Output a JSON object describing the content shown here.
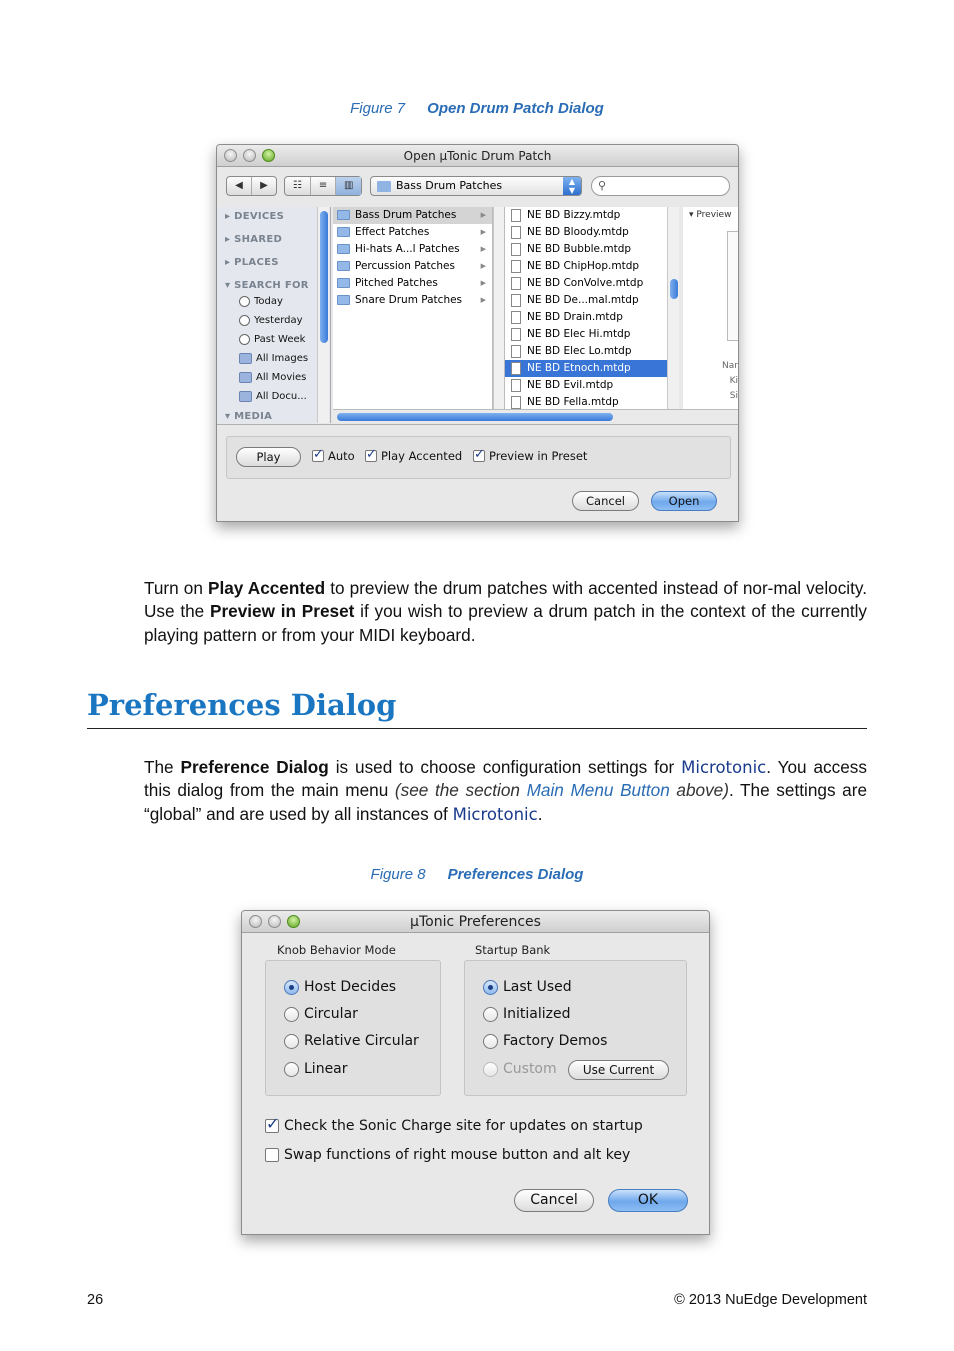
{
  "figure7": {
    "number": "Figure 7",
    "title": "Open Drum Patch Dialog"
  },
  "open_dialog": {
    "title": "Open µTonic Drum Patch",
    "nav_back": "◀",
    "nav_forward": "▶",
    "view_icon": "☷",
    "view_list": "≡",
    "view_columns": "▥",
    "location": "Bass Drum Patches",
    "search_icon": "⚲",
    "sidebar": {
      "devices": "DEVICES",
      "shared": "SHARED",
      "places": "PLACES",
      "search_for": "SEARCH FOR",
      "items": [
        "Today",
        "Yesterday",
        "Past Week",
        "All Images",
        "All Movies",
        "All Docu..."
      ],
      "media": "MEDIA"
    },
    "folders": [
      "Bass Drum Patches",
      "Effect Patches",
      "Hi-hats A...l Patches",
      "Percussion Patches",
      "Pitched Patches",
      "Snare Drum Patches"
    ],
    "files": [
      "NE BD Bizzy.mtdp",
      "NE BD Bloody.mtdp",
      "NE BD Bubble.mtdp",
      "NE BD ChipHop.mtdp",
      "NE BD ConVolve.mtdp",
      "NE BD De...mal.mtdp",
      "NE BD Drain.mtdp",
      "NE BD Elec Hi.mtdp",
      "NE BD Elec Lo.mtdp",
      "NE BD Etnoch.mtdp",
      "NE BD Evil.mtdp",
      "NE BD Fella.mtdp"
    ],
    "selected_file": 9,
    "preview_header": "Preview",
    "preview_labels": [
      "Nar",
      "Ki",
      "Si"
    ],
    "play_label": "Play",
    "auto_label": "Auto",
    "play_accented_label": "Play Accented",
    "preview_in_preset_label": "Preview in Preset",
    "cancel_label": "Cancel",
    "open_label": "Open"
  },
  "para1": {
    "p1": "Turn on ",
    "b1": "Play Accented",
    "p2": " to preview the drum patches with accented instead of nor-mal velocity. Use the ",
    "b2": "Preview in Preset",
    "p3": " if you wish to preview a drum patch in the context of the currently playing pattern or from your MIDI keyboard."
  },
  "section_title": "Preferences Dialog",
  "para2": {
    "p1": "The ",
    "b1": "Preference Dialog",
    "p2": " is used to choose configuration settings for ",
    "brand": "Microtonic",
    "p3": ". You access this dialog from the main menu ",
    "i1": "(see the section ",
    "link": "Main Menu Button",
    "i2": " above)",
    "p4": ". The settings are “global” and are used by all instances of ",
    "brand2": "Microtonic",
    "p5": "."
  },
  "figure8": {
    "number": "Figure 8",
    "title": "Preferences Dialog"
  },
  "pref_dialog": {
    "title": "µTonic Preferences",
    "knob_group": "Knob Behavior Mode",
    "knob_options": [
      "Host Decides",
      "Circular",
      "Relative Circular",
      "Linear"
    ],
    "knob_selected": 0,
    "bank_group": "Startup Bank",
    "bank_options": [
      "Last Used",
      "Initialized",
      "Factory Demos",
      "Custom"
    ],
    "bank_selected": 0,
    "use_current_label": "Use Current",
    "check_updates_label": "Check the Sonic Charge site for updates on startup",
    "check_updates": true,
    "swap_label": "Swap functions of right mouse button and alt key",
    "swap": false,
    "cancel_label": "Cancel",
    "ok_label": "OK"
  },
  "footer": {
    "page": "26",
    "copyright": "© 2013 NuEdge Development"
  }
}
